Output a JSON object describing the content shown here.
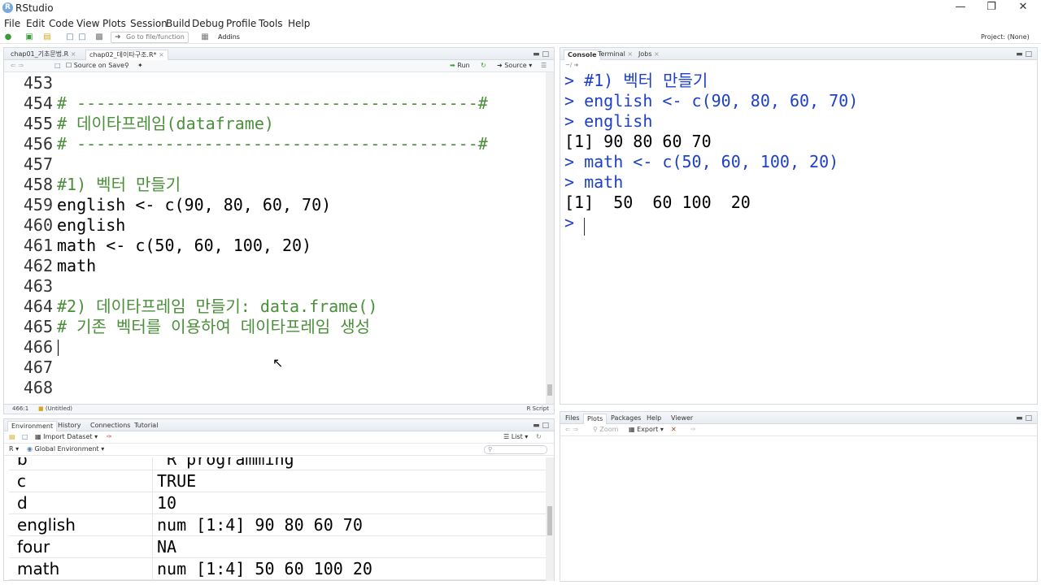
{
  "window": {
    "title": "RStudio",
    "app_icon": "R"
  },
  "menubar": [
    "File",
    "Edit",
    "Code",
    "View",
    "Plots",
    "Session",
    "Build",
    "Debug",
    "Profile",
    "Tools",
    "Help"
  ],
  "toolbar": {
    "goto_placeholder": "Go to file/function",
    "addins_label": "Addins",
    "project_label": "Project: (None)"
  },
  "editor": {
    "tabs": [
      "chap01_기초문법.R",
      "chap02_데이타구조.R*"
    ],
    "source_on_save": "Source on Save",
    "run_label": "Run",
    "source_label": "Source",
    "lines": [
      {
        "n": "453",
        "t": ""
      },
      {
        "n": "454",
        "t": "# -----------------------------------------#",
        "c": "comment"
      },
      {
        "n": "455",
        "t": "# 데이타프레임(dataframe)",
        "c": "comment"
      },
      {
        "n": "456",
        "t": "# -----------------------------------------#",
        "c": "comment"
      },
      {
        "n": "457",
        "t": ""
      },
      {
        "n": "458",
        "t": "#1) 벡터 만들기",
        "c": "comment"
      },
      {
        "n": "459",
        "t": "english <- c(90, 80, 60, 70)"
      },
      {
        "n": "460",
        "t": "english"
      },
      {
        "n": "461",
        "t": "math <- c(50, 60, 100, 20)"
      },
      {
        "n": "462",
        "t": "math"
      },
      {
        "n": "463",
        "t": ""
      },
      {
        "n": "464",
        "t": "#2) 데이타프레임 만들기: data.frame()",
        "c": "comment"
      },
      {
        "n": "465",
        "t": "# 기존 벡터를 이용하여 데이타프레임 생성",
        "c": "comment"
      },
      {
        "n": "466",
        "t": ""
      },
      {
        "n": "467",
        "t": ""
      },
      {
        "n": "468",
        "t": ""
      }
    ],
    "status_position": "466:1",
    "status_scope": "(Untitled)",
    "status_filetype": "R Script"
  },
  "console": {
    "tabs": [
      "Console",
      "Terminal",
      "Jobs"
    ],
    "path": "~/",
    "lines": [
      {
        "t": "> #1) 벡터 만들기",
        "k": "in"
      },
      {
        "t": "> english <- c(90, 80, 60, 70)",
        "k": "in"
      },
      {
        "t": "> english",
        "k": "in"
      },
      {
        "t": "[1] 90 80 60 70",
        "k": "out"
      },
      {
        "t": "> math <- c(50, 60, 100, 20)",
        "k": "in"
      },
      {
        "t": "> math",
        "k": "in"
      },
      {
        "t": "[1]  50  60 100  20",
        "k": "out"
      },
      {
        "t": "> ",
        "k": "in"
      }
    ]
  },
  "environment": {
    "tabs": [
      "Environment",
      "History",
      "Connections",
      "Tutorial"
    ],
    "import_label": "Import Dataset",
    "view_label": "List",
    "lang_label": "R",
    "scope_label": "Global Environment",
    "rows": [
      {
        "name": "b",
        "value": "\"R programming\""
      },
      {
        "name": "c",
        "value": "TRUE"
      },
      {
        "name": "d",
        "value": "10"
      },
      {
        "name": "english",
        "value": "num [1:4] 90 80 60 70"
      },
      {
        "name": "four",
        "value": "NA"
      },
      {
        "name": "math",
        "value": "num [1:4] 50 60 100 20"
      }
    ]
  },
  "files": {
    "tabs": [
      "Files",
      "Plots",
      "Packages",
      "Help",
      "Viewer"
    ],
    "zoom_label": "Zoom",
    "export_label": "Export"
  }
}
